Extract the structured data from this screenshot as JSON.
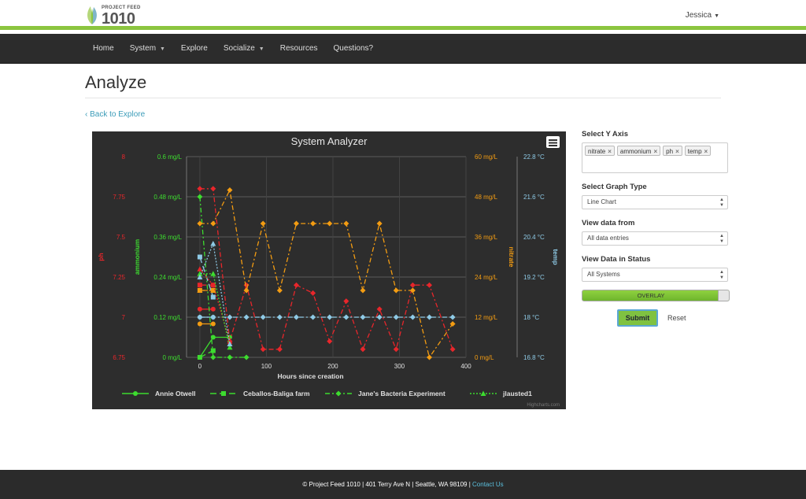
{
  "header": {
    "logo_small": "PROJECT FEED",
    "logo_big": "1010",
    "user": "Jessica"
  },
  "nav": {
    "items": [
      {
        "label": "Home",
        "dropdown": false
      },
      {
        "label": "System",
        "dropdown": true
      },
      {
        "label": "Explore",
        "dropdown": false
      },
      {
        "label": "Socialize",
        "dropdown": true
      },
      {
        "label": "Resources",
        "dropdown": false
      },
      {
        "label": "Questions?",
        "dropdown": false
      }
    ]
  },
  "page": {
    "title": "Analyze",
    "back_link": "Back to Explore"
  },
  "panel": {
    "y_axis_label": "Select Y Axis",
    "tags": [
      "nitrate",
      "ammonium",
      "ph",
      "temp"
    ],
    "graph_type_label": "Select Graph Type",
    "graph_type_value": "Line Chart",
    "view_from_label": "View data from",
    "view_from_value": "All data entries",
    "status_label": "View Data in Status",
    "status_value": "All Systems",
    "overlay_label": "OVERLAY",
    "submit_label": "Submit",
    "reset_label": "Reset"
  },
  "footer": {
    "text": "© Project Feed 1010 | 401 Terry Ave N | Seattle, WA 98109 | ",
    "contact": "Contact Us"
  },
  "colors": {
    "ph": "#e8262b",
    "ammonium": "#3ddc2f",
    "nitrate": "#f39c12",
    "temp": "#8ecae6",
    "chart_bg": "#2d2d2d",
    "nav_bg": "#2c2c2c",
    "accent": "#8bc53f"
  },
  "chart_data": {
    "type": "line",
    "title": "System Analyzer",
    "xlabel": "Hours since creation",
    "xlim": [
      -20,
      400
    ],
    "xticks": [
      0,
      100,
      200,
      300,
      400
    ],
    "credits": "Highcharts.com",
    "axes": [
      {
        "key": "ph",
        "title": "ph",
        "side": "left",
        "min": 6.75,
        "max": 8,
        "ticks": [
          "6.75",
          "7",
          "7.25",
          "7.5",
          "7.75",
          "8"
        ],
        "color": "#e8262b"
      },
      {
        "key": "ammonium",
        "title": "ammonium",
        "side": "left",
        "min": 0,
        "max": 0.6,
        "ticks": [
          "0 mg/L",
          "0.12 mg/L",
          "0.24 mg/L",
          "0.36 mg/L",
          "0.48 mg/L",
          "0.6 mg/L"
        ],
        "color": "#3ddc2f"
      },
      {
        "key": "nitrate",
        "title": "nitrate",
        "side": "right",
        "min": 0,
        "max": 60,
        "ticks": [
          "0 mg/L",
          "12 mg/L",
          "24 mg/L",
          "36 mg/L",
          "48 mg/L",
          "60 mg/L"
        ],
        "color": "#f39c12"
      },
      {
        "key": "temp",
        "title": "temp",
        "side": "right",
        "min": 16.8,
        "max": 22.8,
        "ticks": [
          "16.8 °C",
          "18 °C",
          "19.2 °C",
          "20.4 °C",
          "21.6 °C",
          "22.8 °C"
        ],
        "color": "#8ecae6"
      }
    ],
    "legend": [
      {
        "name": "Annie Otwell",
        "marker": "circle",
        "dash": "solid"
      },
      {
        "name": "Ceballos-Baliga farm",
        "marker": "square",
        "dash": "longdash"
      },
      {
        "name": "Jane's Bacteria Experiment",
        "marker": "diamond",
        "dash": "dashdot"
      },
      {
        "name": "jlausted1",
        "marker": "triangle",
        "dash": "dot"
      }
    ],
    "series": [
      {
        "system": "Annie Otwell",
        "axis": "ph",
        "marker": "circle",
        "dash": "solid",
        "points": [
          [
            0,
            7.05
          ],
          [
            20,
            7.05
          ]
        ]
      },
      {
        "system": "Annie Otwell",
        "axis": "ammonium",
        "marker": "circle",
        "dash": "solid",
        "points": [
          [
            0,
            0
          ],
          [
            20,
            0.06
          ],
          [
            45,
            0.06
          ]
        ]
      },
      {
        "system": "Annie Otwell",
        "axis": "nitrate",
        "marker": "circle",
        "dash": "solid",
        "points": [
          [
            0,
            10
          ],
          [
            20,
            10
          ]
        ]
      },
      {
        "system": "Annie Otwell",
        "axis": "temp",
        "marker": "circle",
        "dash": "solid",
        "points": [
          [
            0,
            18
          ],
          [
            20,
            18
          ]
        ]
      },
      {
        "system": "Ceballos-Baliga farm",
        "axis": "ph",
        "marker": "square",
        "dash": "longdash",
        "points": [
          [
            0,
            7.2
          ],
          [
            20,
            7.2
          ]
        ]
      },
      {
        "system": "Ceballos-Baliga farm",
        "axis": "ammonium",
        "marker": "square",
        "dash": "longdash",
        "points": [
          [
            0,
            0
          ],
          [
            20,
            0.02
          ]
        ]
      },
      {
        "system": "Ceballos-Baliga farm",
        "axis": "nitrate",
        "marker": "square",
        "dash": "longdash",
        "points": [
          [
            0,
            20
          ],
          [
            20,
            20
          ]
        ]
      },
      {
        "system": "Ceballos-Baliga farm",
        "axis": "temp",
        "marker": "square",
        "dash": "longdash",
        "points": [
          [
            0,
            19.8
          ],
          [
            20,
            18.6
          ]
        ]
      },
      {
        "system": "Jane's Bacteria Experiment",
        "axis": "ph",
        "marker": "diamond",
        "dash": "dashdot",
        "points": [
          [
            0,
            7.8
          ],
          [
            20,
            7.8
          ],
          [
            45,
            6.85
          ],
          [
            70,
            7.2
          ],
          [
            95,
            6.8
          ],
          [
            120,
            6.8
          ],
          [
            145,
            7.2
          ],
          [
            170,
            7.15
          ],
          [
            195,
            6.85
          ],
          [
            220,
            7.1
          ],
          [
            245,
            6.8
          ],
          [
            270,
            7.05
          ],
          [
            295,
            6.8
          ],
          [
            320,
            7.2
          ],
          [
            345,
            7.2
          ],
          [
            380,
            6.8
          ]
        ]
      },
      {
        "system": "Jane's Bacteria Experiment",
        "axis": "ammonium",
        "marker": "diamond",
        "dash": "dashdot",
        "points": [
          [
            0,
            0.48
          ],
          [
            20,
            0
          ],
          [
            45,
            0
          ],
          [
            70,
            0
          ]
        ]
      },
      {
        "system": "Jane's Bacteria Experiment",
        "axis": "nitrate",
        "marker": "diamond",
        "dash": "dashdot",
        "points": [
          [
            0,
            40
          ],
          [
            20,
            40
          ],
          [
            45,
            50
          ],
          [
            70,
            20
          ],
          [
            95,
            40
          ],
          [
            120,
            20
          ],
          [
            145,
            40
          ],
          [
            170,
            40
          ],
          [
            195,
            40
          ],
          [
            220,
            40
          ],
          [
            245,
            20
          ],
          [
            270,
            40
          ],
          [
            295,
            20
          ],
          [
            320,
            20
          ],
          [
            345,
            0
          ],
          [
            380,
            10
          ]
        ]
      },
      {
        "system": "Jane's Bacteria Experiment",
        "axis": "temp",
        "marker": "diamond",
        "dash": "dashdot",
        "points": [
          [
            0,
            18
          ],
          [
            20,
            18
          ],
          [
            45,
            18
          ],
          [
            70,
            18
          ],
          [
            95,
            18
          ],
          [
            120,
            18
          ],
          [
            145,
            18
          ],
          [
            170,
            18
          ],
          [
            195,
            18
          ],
          [
            220,
            18
          ],
          [
            245,
            18
          ],
          [
            270,
            18
          ],
          [
            295,
            18
          ],
          [
            320,
            18
          ],
          [
            345,
            18
          ],
          [
            380,
            18
          ]
        ]
      },
      {
        "system": "jlausted1",
        "axis": "ph",
        "marker": "triangle",
        "dash": "dot",
        "points": [
          [
            0,
            7.3
          ],
          [
            20,
            7.2
          ],
          [
            45,
            6.85
          ]
        ]
      },
      {
        "system": "jlausted1",
        "axis": "ammonium",
        "marker": "triangle",
        "dash": "dot",
        "points": [
          [
            0,
            0.25
          ],
          [
            20,
            0.25
          ],
          [
            45,
            0.03
          ]
        ]
      },
      {
        "system": "jlausted1",
        "axis": "nitrate",
        "marker": "triangle",
        "dash": "dot",
        "points": [
          [
            0,
            20
          ],
          [
            20,
            20
          ]
        ]
      },
      {
        "system": "jlausted1",
        "axis": "temp",
        "marker": "triangle",
        "dash": "dot",
        "points": [
          [
            0,
            19.2
          ],
          [
            20,
            20.2
          ],
          [
            45,
            17.2
          ]
        ]
      }
    ]
  }
}
